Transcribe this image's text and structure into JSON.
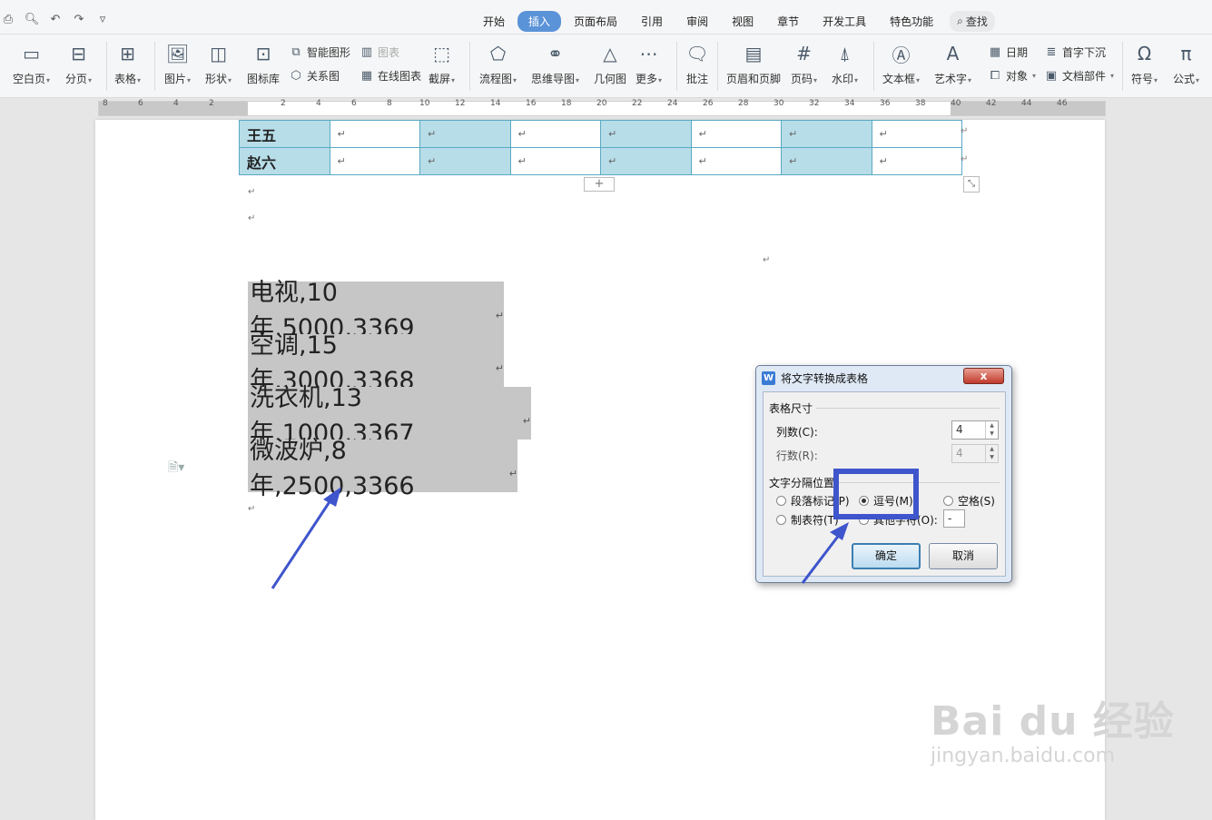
{
  "menu_tabs": [
    {
      "label": "开始",
      "active": false
    },
    {
      "label": "插入",
      "active": true
    },
    {
      "label": "页面布局",
      "active": false
    },
    {
      "label": "引用",
      "active": false
    },
    {
      "label": "审阅",
      "active": false
    },
    {
      "label": "视图",
      "active": false
    },
    {
      "label": "章节",
      "active": false
    },
    {
      "label": "开发工具",
      "active": false
    },
    {
      "label": "特色功能",
      "active": false
    }
  ],
  "search_label": "查找",
  "ribbon": {
    "blank_page": "空白页",
    "page_break": "分页",
    "table": "表格",
    "picture": "图片",
    "shape": "形状",
    "icon_lib": "图标库",
    "smart_shape": "智能图形",
    "chart": "图表",
    "relation_graph": "关系图",
    "online_chart": "在线图表",
    "screenshot": "截屏",
    "flowchart": "流程图",
    "mindmap": "思维导图",
    "geometry": "几何图",
    "more": "更多",
    "comment": "批注",
    "header_footer": "页眉和页脚",
    "page_number": "页码",
    "watermark": "水印",
    "textbox": "文本框",
    "wordart": "艺术字",
    "date": "日期",
    "object": "对象",
    "dropcap": "首字下沉",
    "doc_parts": "文档部件",
    "symbol": "符号",
    "formula": "公式"
  },
  "ruler_numbers": [
    "8",
    "6",
    "4",
    "2",
    "2",
    "4",
    "6",
    "8",
    "10",
    "12",
    "14",
    "16",
    "18",
    "20",
    "22",
    "24",
    "26",
    "28",
    "30",
    "32",
    "34",
    "36",
    "38",
    "40",
    "42",
    "44",
    "46"
  ],
  "table_rows": [
    {
      "name": "王五"
    },
    {
      "name": "赵六"
    }
  ],
  "para_mark": "↵",
  "add_row": "+",
  "text_lines": [
    "电视,10 年,5000,3369",
    "空调,15 年,3000,3368",
    "洗衣机,13 年,1000,3367",
    "微波炉,8 年,2500,3366"
  ],
  "dialog": {
    "title": "将文字转换成表格",
    "close": "x",
    "size_group": "表格尺寸",
    "columns_label": "列数(C):",
    "columns_value": "4",
    "rows_label": "行数(R):",
    "rows_value": "4",
    "sep_group": "文字分隔位置",
    "opt_paragraph": "段落标记(P)",
    "opt_comma": "逗号(M)",
    "opt_space": "空格(S)",
    "opt_tab": "制表符(T)",
    "opt_other": "其他字符(O):",
    "other_value": "-",
    "ok": "确定",
    "cancel": "取消"
  },
  "watermark": {
    "brand": "Bai du 经验",
    "url": "jingyan.baidu.com"
  },
  "colors": {
    "accent": "#5b93d8",
    "table_border": "#5aa9c4",
    "table_fill": "#b7dde8",
    "highlight_box": "#3f55cc",
    "arrow": "#3f55cc"
  }
}
